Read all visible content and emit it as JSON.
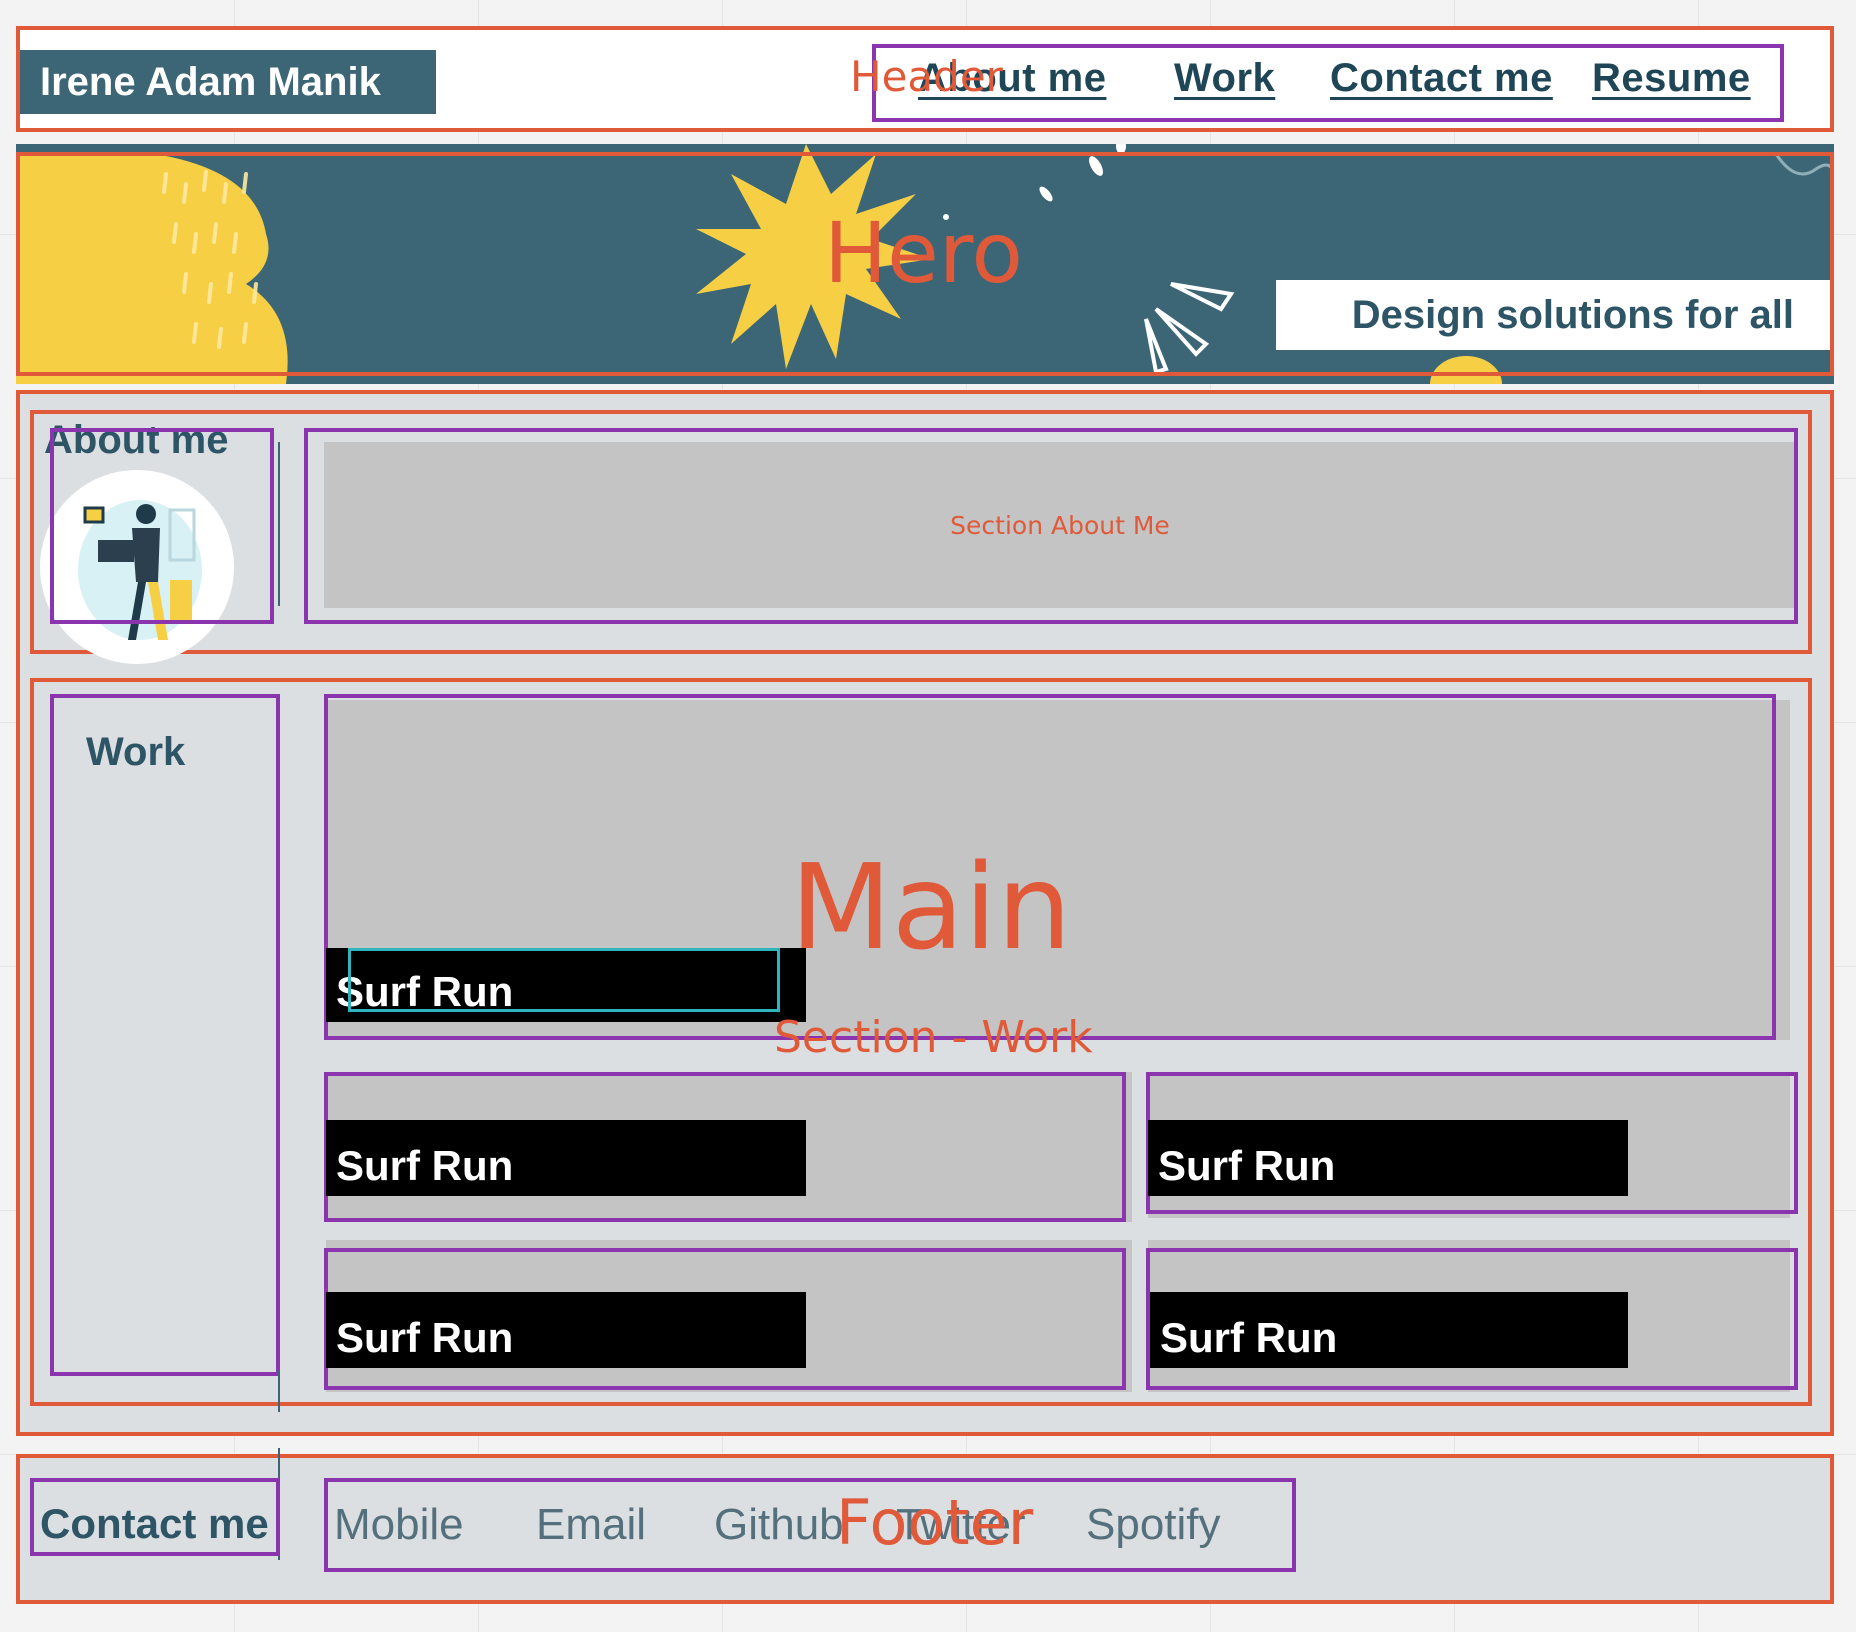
{
  "header": {
    "brand": "Irene Adam Manik",
    "nav": [
      "About me",
      "Work",
      "Contact me",
      "Resume"
    ],
    "annotation": "Header"
  },
  "hero": {
    "annotation": "Hero",
    "tagline": "Design solutions for all"
  },
  "about": {
    "title": "About me",
    "placeholder": "Section About Me"
  },
  "work": {
    "title": "Work",
    "annotation_main": "Main",
    "annotation_section": "Section - Work",
    "cards": [
      "Surf Run",
      "Surf Run",
      "Surf Run",
      "Surf Run",
      "Surf Run"
    ]
  },
  "footer": {
    "title": "Contact me",
    "links": [
      "Mobile",
      "Email",
      "Github",
      "Twitter",
      "Spotify"
    ],
    "annotation": "Footer"
  },
  "colors": {
    "annotation_orange": "#e05a3a",
    "annotation_purple": "#8a35ad",
    "annotation_teal": "#2fb3bd",
    "brand_teal": "#3c6676",
    "hero_yellow": "#f6cf45"
  }
}
